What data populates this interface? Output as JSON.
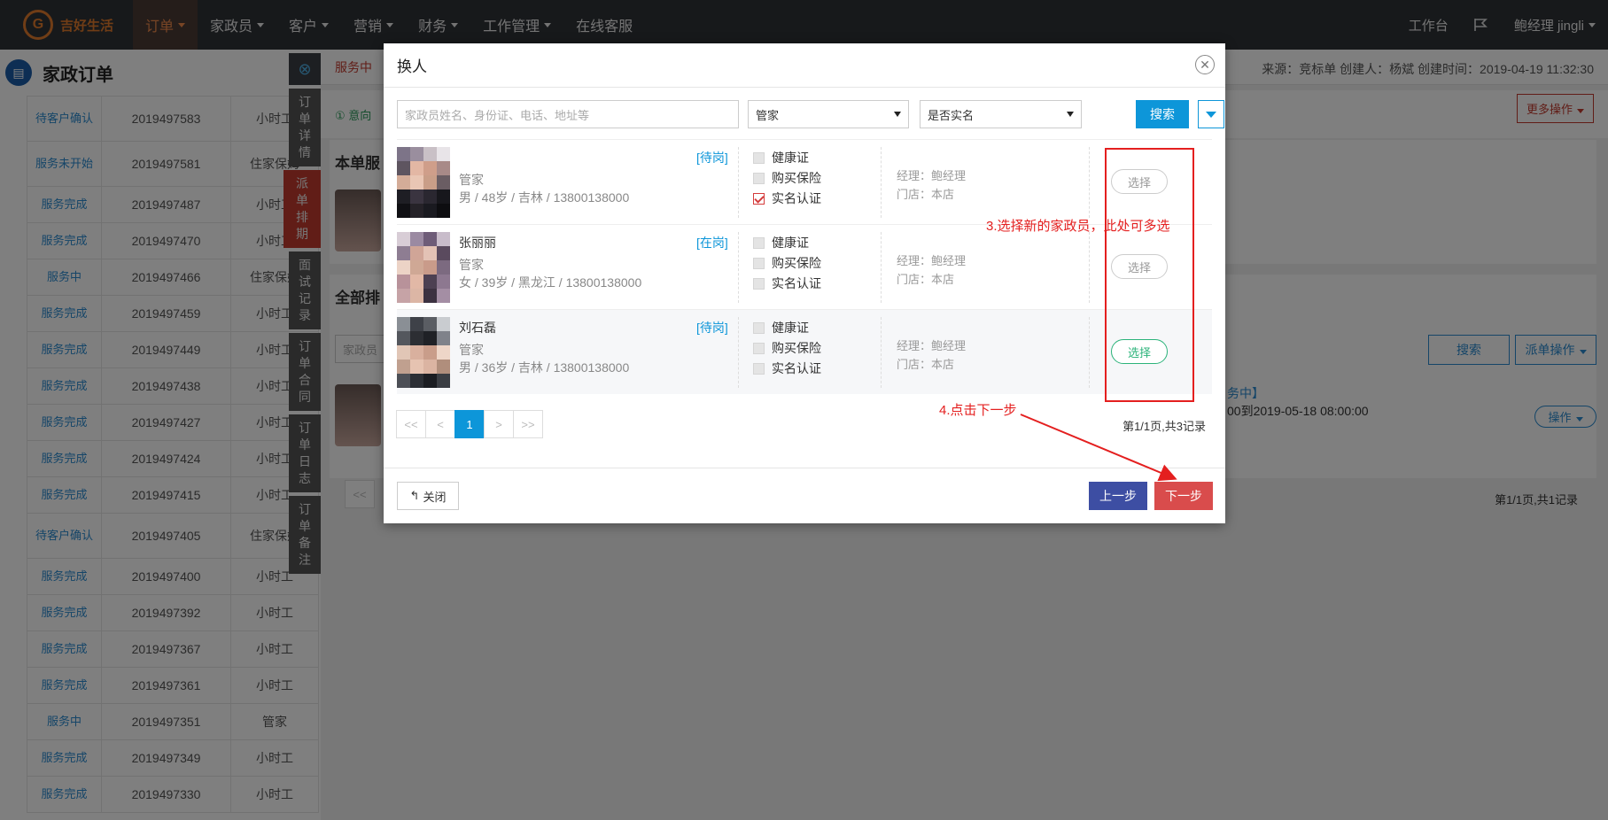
{
  "topnav": {
    "logo_mark": "G",
    "logo_text": "吉好生活",
    "items": [
      {
        "label": "订单",
        "active": true
      },
      {
        "label": "家政员"
      },
      {
        "label": "客户"
      },
      {
        "label": "营销"
      },
      {
        "label": "财务"
      },
      {
        "label": "工作管理"
      }
    ],
    "support": "在线客服",
    "workbench": "工作台",
    "user": "鲍经理  jingli"
  },
  "left": {
    "title": "家政订单",
    "rows": [
      {
        "status": "待客户确认",
        "no": "2019497583",
        "type": "小时工",
        "tall": true
      },
      {
        "status": "服务未开始",
        "no": "2019497581",
        "type": "住家保姆",
        "tall": true
      },
      {
        "status": "服务完成",
        "no": "2019497487",
        "type": "小时工"
      },
      {
        "status": "服务完成",
        "no": "2019497470",
        "type": "小时工"
      },
      {
        "status": "服务中",
        "no": "2019497466",
        "type": "住家保姆"
      },
      {
        "status": "服务完成",
        "no": "2019497459",
        "type": "小时工"
      },
      {
        "status": "服务完成",
        "no": "2019497449",
        "type": "小时工"
      },
      {
        "status": "服务完成",
        "no": "2019497438",
        "type": "小时工"
      },
      {
        "status": "服务完成",
        "no": "2019497427",
        "type": "小时工"
      },
      {
        "status": "服务完成",
        "no": "2019497424",
        "type": "小时工"
      },
      {
        "status": "服务完成",
        "no": "2019497415",
        "type": "小时工"
      },
      {
        "status": "待客户确认",
        "no": "2019497405",
        "type": "住家保姆",
        "tall": true
      },
      {
        "status": "服务完成",
        "no": "2019497400",
        "type": "小时工"
      },
      {
        "status": "服务完成",
        "no": "2019497392",
        "type": "小时工"
      },
      {
        "status": "服务完成",
        "no": "2019497367",
        "type": "小时工"
      },
      {
        "status": "服务完成",
        "no": "2019497361",
        "type": "小时工"
      },
      {
        "status": "服务中",
        "no": "2019497351",
        "type": "管家"
      },
      {
        "status": "服务完成",
        "no": "2019497349",
        "type": "小时工"
      },
      {
        "status": "服务完成",
        "no": "2019497330",
        "type": "小时工"
      }
    ],
    "tabs": [
      "订单详情",
      "派单排期",
      "面试记录",
      "订单合同",
      "订单日志",
      "订单备注"
    ]
  },
  "right": {
    "status_tag": "服务中",
    "meta": "来源：竞标单    创建人：杨斌    创建时间：2019-04-19 11:32:30",
    "intent": "① 意向",
    "more_ops": "更多操作",
    "section1": "本单服",
    "section2": "全部排",
    "filter_placeholder": "家政员",
    "search": "搜索",
    "dispatch_ops": "派单操作",
    "order_status": "务中】",
    "order_time": "00到2019-05-18 08:00:00",
    "op": "操作",
    "pager_first": "<<",
    "page_info": "第1/1页,共1记录"
  },
  "modal": {
    "title": "换人",
    "search_placeholder": "家政员姓名、身份证、电话、地址等",
    "type_select": "管家",
    "realname_select": "是否实名",
    "search_btn": "搜索",
    "candidates": [
      {
        "name": "",
        "status": "[待岗]",
        "role": "管家",
        "info": "男 / 48岁 / 吉林 / 13800138000",
        "health": "健康证",
        "insurance": "购买保险",
        "realname": "实名认证",
        "realname_checked": true,
        "manager": "经理：鲍经理",
        "store": "门店：本店",
        "pick": "选择",
        "picked": false
      },
      {
        "name": "张丽丽",
        "status": "[在岗]",
        "role": "管家",
        "info": "女 / 39岁 / 黑龙江 / 13800138000",
        "health": "健康证",
        "insurance": "购买保险",
        "realname": "实名认证",
        "realname_checked": false,
        "manager": "经理：鲍经理",
        "store": "门店：本店",
        "pick": "选择",
        "picked": false
      },
      {
        "name": "刘石磊",
        "status": "[待岗]",
        "role": "管家",
        "info": "男 / 36岁 / 吉林 / 13800138000",
        "health": "健康证",
        "insurance": "购买保险",
        "realname": "实名认证",
        "realname_checked": false,
        "manager": "经理：鲍经理",
        "store": "门店：本店",
        "pick": "选择",
        "picked": true
      }
    ],
    "pager": {
      "first": "<<",
      "prev": "<",
      "current": "1",
      "next": ">",
      "last": ">>"
    },
    "page_info": "第1/1页,共3记录",
    "close": "关闭",
    "prev_step": "上一步",
    "next_step": "下一步"
  },
  "annotations": {
    "step3": "3.选择新的家政员，此处可多选",
    "step4": "4.点击下一步",
    "color": "#e41f1f"
  }
}
